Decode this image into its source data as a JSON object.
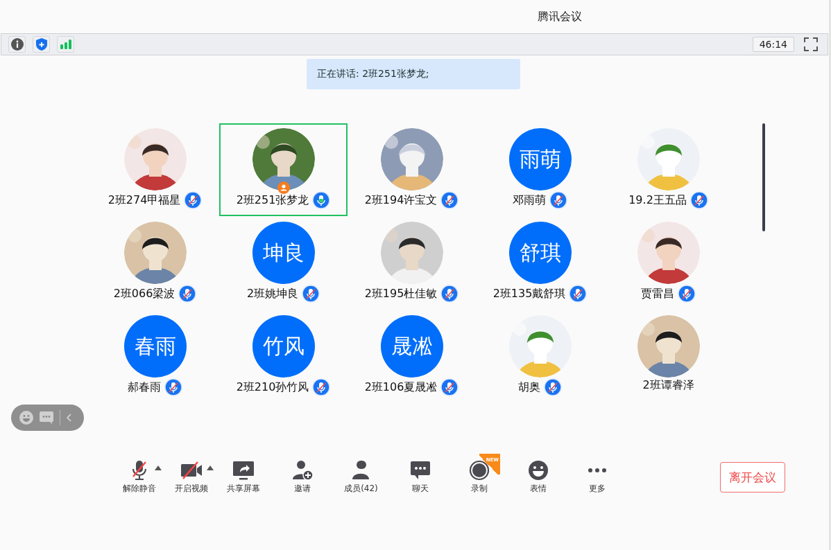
{
  "window": {
    "title": "腾讯会议"
  },
  "info_bar": {
    "timer": "46:14"
  },
  "speaking_banner": "正在讲话: 2班251张梦龙;",
  "participants": [
    {
      "name": "2班274甲福星",
      "muted": true,
      "speaking": false,
      "selected": false,
      "host": false
    },
    {
      "name": "2班251张梦龙",
      "muted": false,
      "speaking": true,
      "selected": true,
      "host": true
    },
    {
      "name": "2班194许宝文",
      "muted": true,
      "speaking": false,
      "selected": false,
      "host": false
    },
    {
      "name": "邓雨萌",
      "avatar": {
        "kind": "text",
        "text": "雨萌"
      },
      "muted": true,
      "speaking": false,
      "selected": false,
      "host": false
    },
    {
      "name": "19.2王五品",
      "muted": true,
      "speaking": false,
      "selected": false,
      "host": false
    },
    {
      "name": "2班066梁波",
      "muted": true,
      "speaking": false,
      "selected": false,
      "host": false
    },
    {
      "name": "2班姚坤良",
      "avatar": {
        "kind": "text",
        "text": "坤良"
      },
      "muted": true,
      "speaking": false,
      "selected": false,
      "host": false
    },
    {
      "name": "2班195杜佳敏",
      "muted": true,
      "speaking": false,
      "selected": false,
      "host": false
    },
    {
      "name": "2班135戴舒琪",
      "avatar": {
        "kind": "text",
        "text": "舒琪"
      },
      "muted": true,
      "speaking": false,
      "selected": false,
      "host": false
    },
    {
      "name": "贾雷昌",
      "muted": true,
      "speaking": false,
      "selected": false,
      "host": false
    },
    {
      "name": "郝春雨",
      "avatar": {
        "kind": "text",
        "text": "春雨"
      },
      "muted": true,
      "speaking": false,
      "selected": false,
      "host": false
    },
    {
      "name": "2班210孙竹风",
      "avatar": {
        "kind": "text",
        "text": "竹风"
      },
      "muted": true,
      "speaking": false,
      "selected": false,
      "host": false
    },
    {
      "name": "2班106夏晟凇",
      "avatar": {
        "kind": "text",
        "text": "晟凇"
      },
      "muted": true,
      "speaking": false,
      "selected": false,
      "host": false
    },
    {
      "name": "胡奥",
      "muted": true,
      "speaking": false,
      "selected": false,
      "host": false
    },
    {
      "name": "2班谭睿泽",
      "muted": false,
      "speaking": false,
      "selected": false,
      "host": false
    }
  ],
  "toolbar": [
    {
      "kind": "mic-off",
      "label": "解除静音",
      "caret": true
    },
    {
      "kind": "video-off",
      "label": "开启视频",
      "caret": true
    },
    {
      "kind": "share",
      "label": "共享屏幕",
      "caret": false
    },
    {
      "kind": "invite",
      "label": "邀请",
      "caret": false
    },
    {
      "kind": "members",
      "label": "成员(42)",
      "caret": false
    },
    {
      "kind": "chat",
      "label": "聊天",
      "caret": false
    },
    {
      "kind": "record",
      "label": "录制",
      "caret": false,
      "badge": "NEW"
    },
    {
      "kind": "emoji",
      "label": "表情",
      "caret": false
    },
    {
      "kind": "more",
      "label": "更多",
      "caret": false
    }
  ],
  "leave_button": "离开会议"
}
